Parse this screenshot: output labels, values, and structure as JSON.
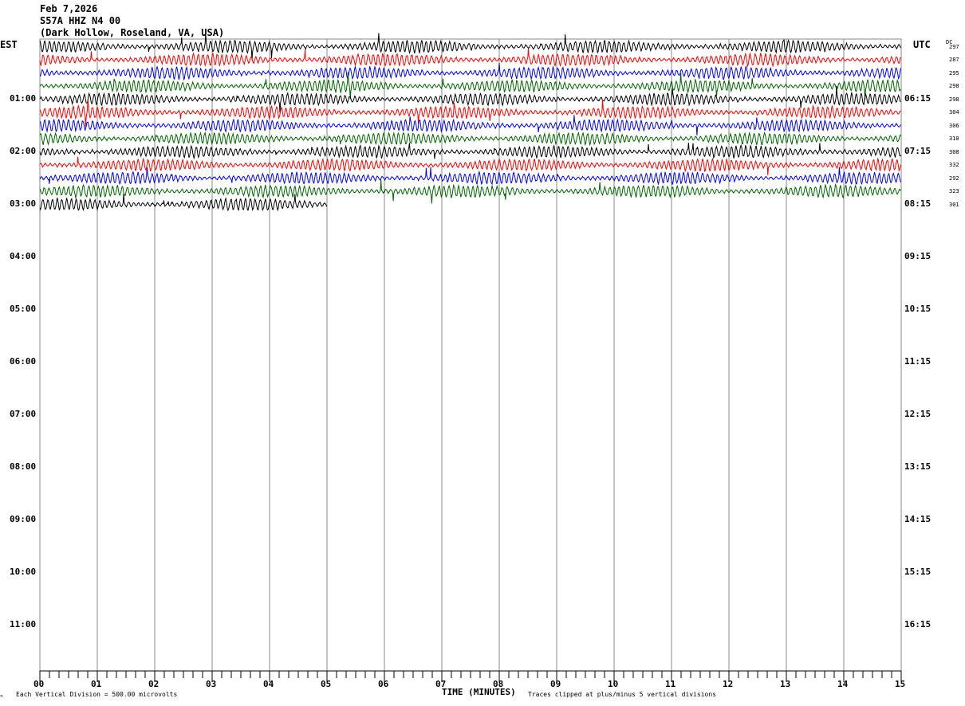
{
  "header": {
    "date": "Feb 7,2026",
    "station": "S57A HHZ N4 00",
    "location": "(Dark Hollow, Roseland, VA, USA)"
  },
  "chart_data": {
    "type": "line",
    "left_axis_label": "EST",
    "right_axis_label": "UTC",
    "dc_label": "DC",
    "xlabel": "TIME (MINUTES)",
    "xlim": [
      0,
      15
    ],
    "x_ticks": [
      "00",
      "01",
      "02",
      "03",
      "04",
      "05",
      "06",
      "07",
      "08",
      "09",
      "10",
      "11",
      "12",
      "13",
      "14",
      "15"
    ],
    "minor_tick_seconds": 10,
    "rows_per_hour": 4,
    "est_hour_labels": [
      "01:00",
      "02:00",
      "03:00",
      "04:00",
      "05:00",
      "06:00",
      "07:00",
      "08:00",
      "09:00",
      "10:00",
      "11:00"
    ],
    "utc_hour_labels": [
      "06:15",
      "07:15",
      "08:15",
      "09:15",
      "10:15",
      "11:15",
      "12:15",
      "13:15",
      "14:15",
      "15:15",
      "16:15"
    ],
    "trace_colors": [
      "#000000",
      "#ff0000",
      "#0000ff",
      "#006400"
    ],
    "traces": [
      {
        "dc": "297",
        "minutes": 15
      },
      {
        "dc": "287",
        "minutes": 15
      },
      {
        "dc": "295",
        "minutes": 15
      },
      {
        "dc": "298",
        "minutes": 15
      },
      {
        "dc": "298",
        "minutes": 15
      },
      {
        "dc": "304",
        "minutes": 15
      },
      {
        "dc": "306",
        "minutes": 15
      },
      {
        "dc": "310",
        "minutes": 15
      },
      {
        "dc": "308",
        "minutes": 15
      },
      {
        "dc": "332",
        "minutes": 15
      },
      {
        "dc": "292",
        "minutes": 15
      },
      {
        "dc": "323",
        "minutes": 15
      },
      {
        "dc": "301",
        "minutes": 5
      }
    ],
    "footer_left": "Each Vertical Division =  500.00 microvolts",
    "footer_right": "Traces clipped at plus/minus 5 vertical divisions"
  }
}
